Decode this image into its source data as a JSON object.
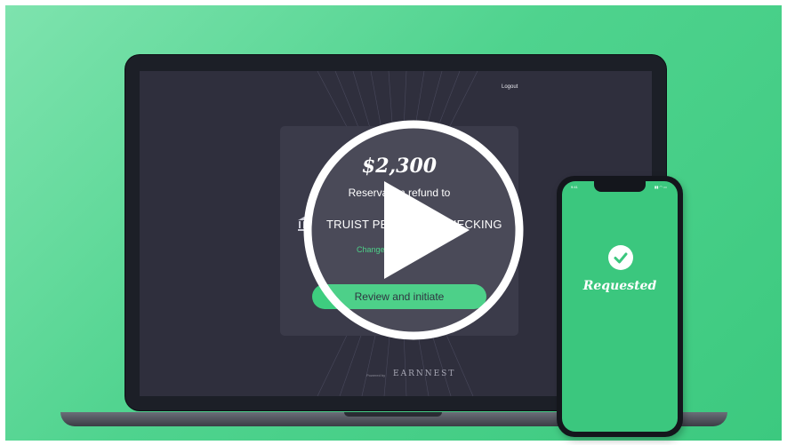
{
  "laptop": {
    "header": {
      "logout_label": "Logout"
    },
    "card": {
      "amount": "$2,300",
      "subtitle": "Reservation refund to",
      "bank_name": "TRUIST PERSONAL CHECKING",
      "change_label": "Change",
      "cta_label": "Review and initiate"
    },
    "footer": {
      "powered_by": "Powered by",
      "brand": "EARNNEST"
    }
  },
  "phone": {
    "status_time": "9:41",
    "status_icons": "▮▮ ◠ ▭",
    "status_label": "Requested"
  },
  "overlay": {
    "play_icon": "play-icon"
  },
  "colors": {
    "background": "#4fd38e",
    "screen": "#2f2f3d",
    "card": "#3b3b4a",
    "accent": "#3ecd7f"
  }
}
